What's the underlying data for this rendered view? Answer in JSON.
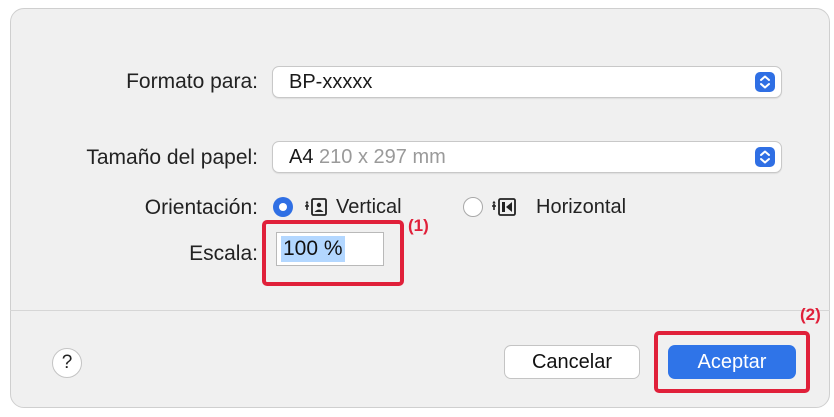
{
  "dialog": {
    "format_for": {
      "label": "Formato para:",
      "value": "BP-xxxxx"
    },
    "paper_size": {
      "label": "Tamaño del papel:",
      "value_main": "A4",
      "value_detail": "210 x 297 mm"
    },
    "orientation": {
      "label": "Orientación:",
      "options": [
        {
          "label": "Vertical",
          "selected": true
        },
        {
          "label": "Horizontal",
          "selected": false
        }
      ]
    },
    "scale": {
      "label": "Escala:",
      "value": "100 %"
    },
    "buttons": {
      "help": "?",
      "cancel": "Cancelar",
      "ok": "Aceptar"
    }
  },
  "annotations": {
    "callout_1": "(1)",
    "callout_2": "(2)"
  },
  "colors": {
    "accent": "#2f74e8",
    "highlight": "#e0203a",
    "selection": "#b3d7ff"
  }
}
